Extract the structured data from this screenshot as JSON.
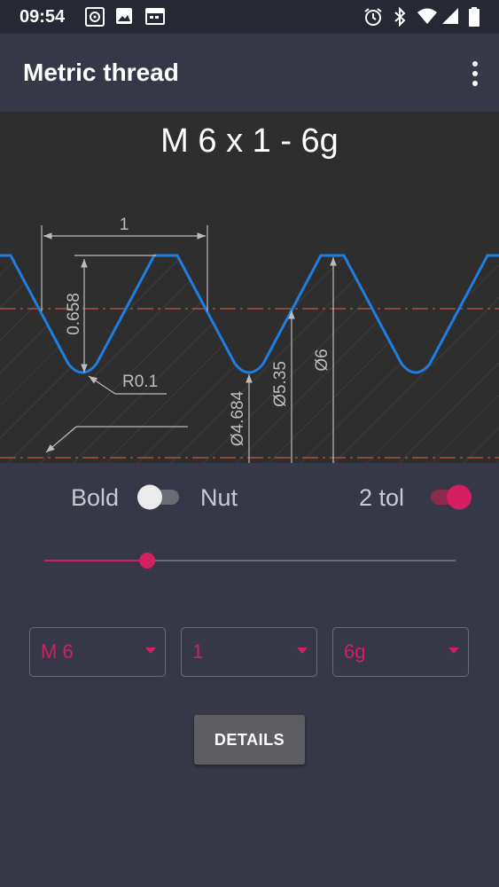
{
  "status_bar": {
    "time": "09:54",
    "left_icons": [
      "radio-icon",
      "image-icon",
      "calendar-icon"
    ],
    "right_icons": [
      "alarm-icon",
      "bluetooth-icon",
      "wifi-icon",
      "signal-icon",
      "battery-icon"
    ]
  },
  "app_bar": {
    "title": "Metric thread",
    "menu_icon": "more-vert-icon"
  },
  "drawing": {
    "title": "M 6 x 1 - 6g",
    "pitch_label": "1",
    "depth_label": "0.658",
    "radius_label": "R0.1",
    "minor_diameter_label": "Ø4.684",
    "pitch_diameter_label": "Ø5.35",
    "major_diameter_label": "Ø6",
    "colors": {
      "profile": "#1f7fe0",
      "centerline": "#c8553d",
      "dimension": "#bdbdbd",
      "background": "#2e2e2e"
    }
  },
  "controls": {
    "bold_label": "Bold",
    "bold_on": false,
    "nut_label": "Nut",
    "tol_label": "2 tol",
    "tol_on": true,
    "slider_fraction": 0.25,
    "accent": "#d41f60",
    "dropdowns": [
      {
        "name": "diameter",
        "value": "M 6"
      },
      {
        "name": "pitch",
        "value": "1"
      },
      {
        "name": "tolerance",
        "value": "6g"
      }
    ],
    "details_label": "DETAILS"
  }
}
